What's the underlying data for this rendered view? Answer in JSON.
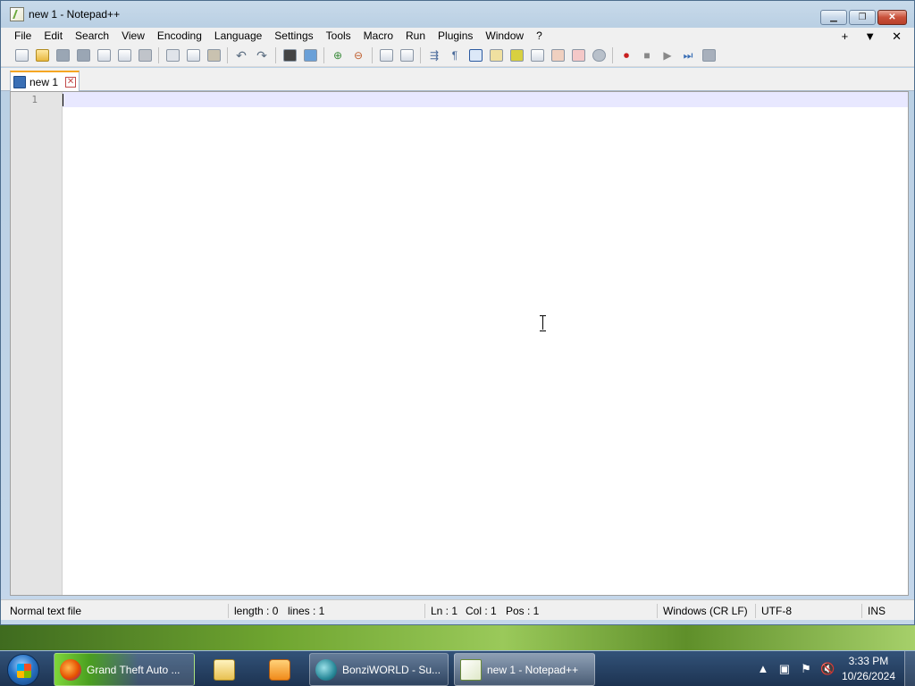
{
  "window": {
    "title": "new 1 - Notepad++"
  },
  "menu": {
    "items": [
      "File",
      "Edit",
      "Search",
      "View",
      "Encoding",
      "Language",
      "Settings",
      "Tools",
      "Macro",
      "Run",
      "Plugins",
      "Window",
      "?"
    ],
    "right_controls": [
      "+",
      "▼",
      "✕"
    ]
  },
  "toolbar": {
    "buttons": [
      "new-file-icon",
      "open-file-icon",
      "save-icon",
      "save-all-icon",
      "close-icon",
      "close-all-icon",
      "print-icon",
      "cut-icon",
      "copy-icon",
      "paste-icon",
      "undo-icon",
      "redo-icon",
      "find-icon",
      "replace-icon",
      "zoom-in-icon",
      "zoom-out-icon",
      "sync-vertical-icon",
      "sync-horizontal-icon",
      "word-wrap-icon",
      "show-all-chars-icon",
      "indent-guide-icon",
      "user-defined-language-icon",
      "document-map-icon",
      "function-list-icon",
      "folder-as-workspace-icon",
      "monitoring-icon",
      "doc-list-icon",
      "record-macro-icon",
      "stop-recording-icon",
      "play-macro-icon",
      "run-macro-multiple-icon",
      "save-macro-icon"
    ]
  },
  "tabs": [
    {
      "label": "new 1"
    }
  ],
  "editor": {
    "line_numbers": [
      "1"
    ],
    "content": ""
  },
  "statusbar": {
    "file_type": "Normal text file",
    "length": "length : 0",
    "lines": "lines : 1",
    "ln": "Ln : 1",
    "col": "Col : 1",
    "pos": "Pos : 1",
    "eol": "Windows (CR LF)",
    "encoding": "UTF-8",
    "mode": "INS"
  },
  "taskbar": {
    "items": [
      {
        "label": "Grand Theft Auto ...",
        "icon": "firefox-icon"
      },
      {
        "label": "",
        "icon": "file-explorer-icon"
      },
      {
        "label": "",
        "icon": "media-player-icon"
      },
      {
        "label": "BonziWORLD - Su...",
        "icon": "bonziworld-icon"
      },
      {
        "label": "new 1 - Notepad++",
        "icon": "notepad-plus-plus-icon"
      }
    ],
    "clock_time": "3:33 PM",
    "clock_date": "10/26/2024"
  },
  "colors": {
    "current_line": "#e8e8ff",
    "tab_accent": "#f5a623",
    "gutter": "#e4e4e4"
  }
}
